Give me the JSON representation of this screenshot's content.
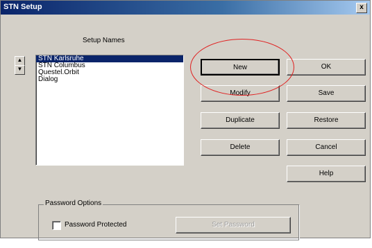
{
  "window": {
    "title": "STN Setup",
    "close_label": "x"
  },
  "setup_names_label": "Setup Names",
  "spinner": {
    "up": "▲",
    "down": "▼"
  },
  "list": {
    "items": [
      "STN Karlsruhe",
      "STN Columbus",
      "Questel.Orbit",
      "Dialog"
    ],
    "selected_index": 0
  },
  "buttons": {
    "new": "New",
    "modify": "Modify",
    "duplicate": "Duplicate",
    "delete": "Delete",
    "ok": "OK",
    "save": "Save",
    "restore": "Restore",
    "cancel": "Cancel",
    "help": "Help",
    "set_password": "Set Password"
  },
  "password_options": {
    "title": "Password Options",
    "checkbox_label": "Password Protected",
    "checked": false
  },
  "annotation": {
    "color": "#e02020",
    "target": "new-button"
  }
}
